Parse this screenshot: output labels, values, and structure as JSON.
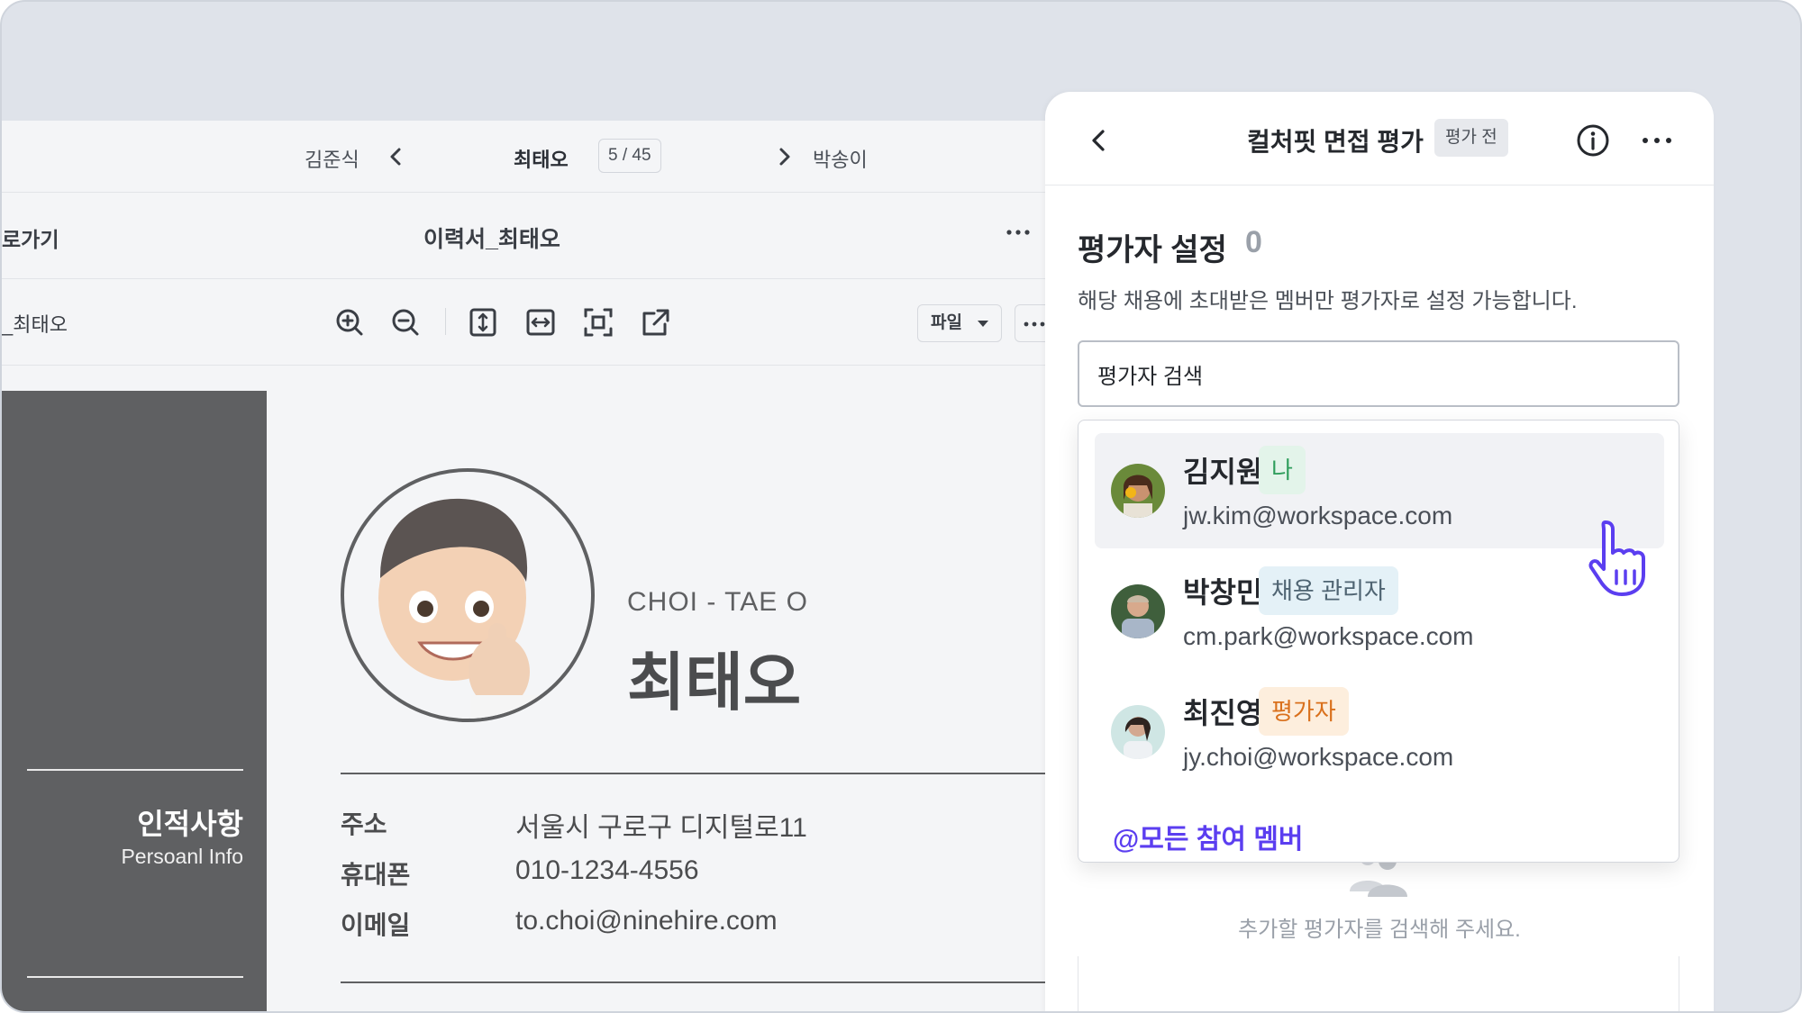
{
  "navigation": {
    "prev_name": "김준식",
    "current_name": "최태오",
    "counter": "5 / 45",
    "next_name": "박송이"
  },
  "document": {
    "back_label": "로가기",
    "title": "이력서_최태오",
    "file_label": "_최태오",
    "file_select": "파일"
  },
  "resume": {
    "section_title": "인적사항",
    "section_subtitle": "Persoanl Info",
    "roman_name": "CHOI - TAE O",
    "korean_name": "최태오",
    "info": [
      {
        "label": "주소",
        "value": "서울시 구로구 디지털로11"
      },
      {
        "label": "휴대폰",
        "value": "010-1234-4556"
      },
      {
        "label": "이메일",
        "value": "to.choi@ninehire.com"
      }
    ]
  },
  "panel": {
    "title": "컬처핏 면접 평가",
    "status_badge": "평가 전",
    "setting_title": "평가자 설정",
    "setting_count": "0",
    "setting_desc": "해당 채용에 초대받은 멤버만 평가자로 설정 가능합니다.",
    "search_value": "평가자 검색",
    "empty_text": "추가할 평가자를 검색해 주세요.",
    "options": [
      {
        "name": "김지원",
        "tag": "나",
        "email": "jw.kim@workspace.com",
        "tag_bg": "#e3f4ea",
        "tag_color": "#2e9d5b"
      },
      {
        "name": "박창민",
        "tag": "채용 관리자",
        "email": "cm.park@workspace.com",
        "tag_bg": "#e4f1f7",
        "tag_color": "#4f6472"
      },
      {
        "name": "최진영",
        "tag": "평가자",
        "email": "jy.choi@workspace.com",
        "tag_bg": "#fdeedd",
        "tag_color": "#d9701c"
      }
    ],
    "all_members": "@모든 참여 멤버"
  },
  "colors": {
    "accent": "#5b3ef0",
    "resume_dark": "#5f6062"
  }
}
